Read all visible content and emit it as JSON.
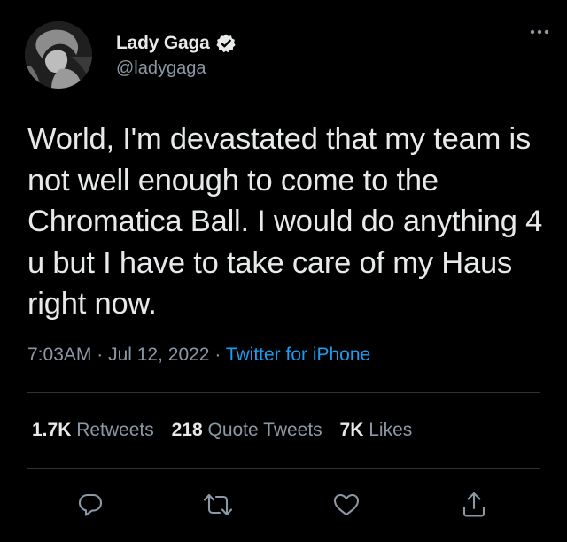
{
  "author": {
    "display_name": "Lady Gaga",
    "handle": "@ladygaga",
    "verified": true,
    "avatar": "avatar-photo"
  },
  "tweet": {
    "text": "World, I'm devastated that my team is not well enough to come to the Chromatica Ball. I would do anything 4 u but I have to take care of my Haus right now.",
    "time": "7:03AM",
    "separator": "·",
    "date": "Jul 12, 2022",
    "source": "Twitter for iPhone"
  },
  "stats": {
    "retweets": {
      "count": "1.7K",
      "label": "Retweets"
    },
    "quote_tweets": {
      "count": "218",
      "label": "Quote Tweets"
    },
    "likes": {
      "count": "7K",
      "label": "Likes"
    }
  },
  "actions": [
    {
      "icon": "reply-icon"
    },
    {
      "icon": "retweet-icon"
    },
    {
      "icon": "like-icon"
    },
    {
      "icon": "share-icon"
    }
  ],
  "colors": {
    "background": "#000000",
    "text": "#e7e9ea",
    "secondary": "#8b98a5",
    "accent": "#1d9bf0",
    "divider": "#2f3336"
  }
}
